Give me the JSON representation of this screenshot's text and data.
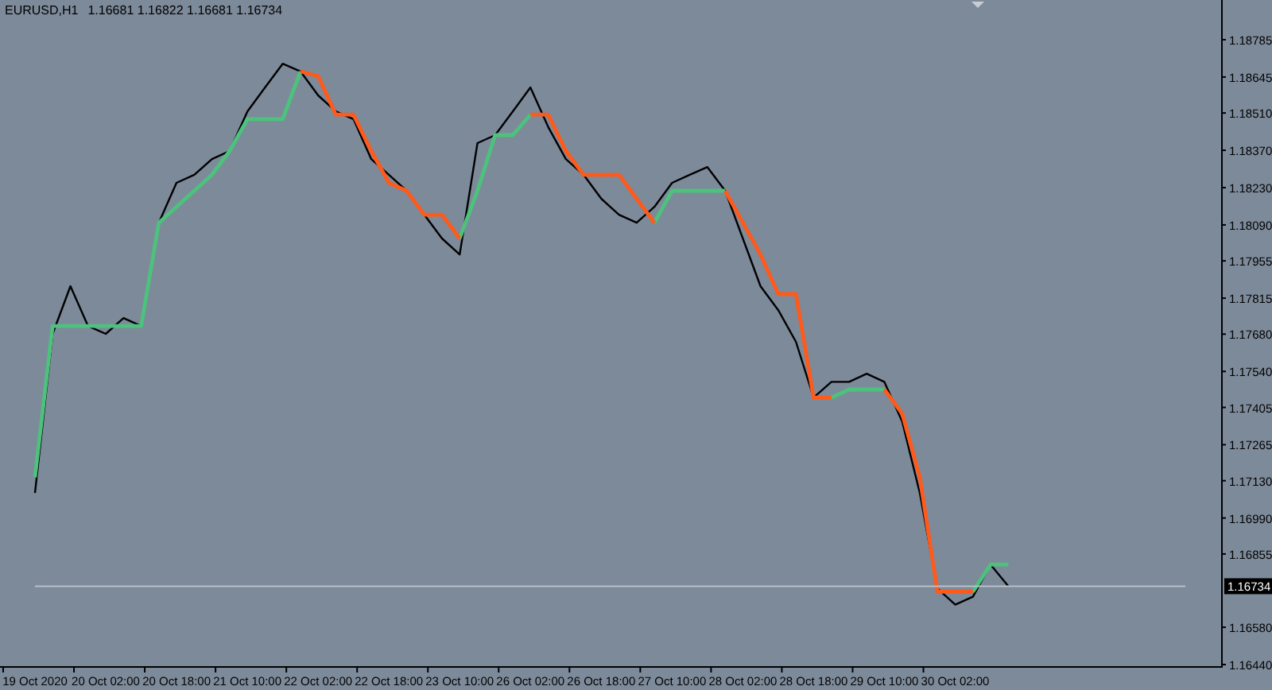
{
  "header": {
    "symbol": "EURUSD,H1",
    "quotes": "1.16681 1.16822 1.16681 1.16734"
  },
  "chart_data": {
    "type": "line",
    "categories": [
      "19 Oct 2020",
      null,
      null,
      null,
      "20 Oct 02:00",
      null,
      null,
      null,
      "20 Oct 18:00",
      null,
      null,
      null,
      "21 Oct 10:00",
      null,
      null,
      null,
      "22 Oct 02:00",
      null,
      null,
      null,
      "22 Oct 18:00",
      null,
      null,
      null,
      "23 Oct 10:00",
      null,
      null,
      null,
      "26 Oct 02:00",
      null,
      null,
      null,
      "26 Oct 18:00",
      null,
      null,
      null,
      "27 Oct 10:00",
      null,
      null,
      null,
      "28 Oct 02:00",
      null,
      null,
      null,
      "28 Oct 18:00",
      null,
      null,
      null,
      "29 Oct 10:00",
      null,
      null,
      null,
      "30 Oct 02:00",
      null,
      null,
      null,
      null,
      null,
      null,
      null,
      null,
      null,
      null,
      null,
      null,
      null
    ],
    "series": [
      {
        "color": "#000000",
        "values": [
          1.17084,
          1.17681,
          1.1786,
          1.1771,
          1.17681,
          1.1774,
          1.1771,
          1.18098,
          1.18248,
          1.18278,
          1.18337,
          1.18367,
          1.18516,
          1.18606,
          1.18695,
          1.18666,
          1.18576,
          1.18516,
          1.18487,
          1.18337,
          1.18278,
          1.18218,
          1.18128,
          1.18039,
          1.17979,
          1.18397,
          1.18427,
          1.18516,
          1.18606,
          1.18457,
          1.18337,
          1.18278,
          1.18188,
          1.18128,
          1.18098,
          1.18158,
          1.18248,
          1.18278,
          1.18307,
          1.18218,
          1.18039,
          1.1786,
          1.1777,
          1.17651,
          1.17442,
          1.17501,
          1.17501,
          1.17531,
          1.17501,
          1.17352,
          1.17084,
          1.16725,
          1.16665,
          1.16695,
          1.16815,
          1.16734,
          null,
          null,
          null,
          null,
          null,
          null,
          null,
          null,
          null,
          null
        ]
      },
      {
        "color": "#4cc27c",
        "values": [
          1.17143,
          1.1771,
          1.1771,
          1.1771,
          1.1771,
          1.1771,
          1.1771,
          1.18098,
          1.18158,
          1.18218,
          1.18278,
          1.18367,
          1.18487,
          1.18487,
          1.18487,
          1.18666,
          null,
          null,
          null,
          null,
          null,
          null,
          null,
          null,
          1.18039,
          1.18218,
          1.18427,
          1.18427,
          1.18504,
          null,
          null,
          null,
          null,
          null,
          null,
          1.18098,
          1.18218,
          1.18218,
          1.18218,
          1.18218,
          null,
          null,
          null,
          null,
          null,
          1.17442,
          1.17472,
          1.17472,
          1.17472,
          null,
          null,
          null,
          null,
          1.16713,
          1.16815,
          1.16815,
          null,
          null,
          null,
          null,
          null,
          null,
          null,
          null,
          null,
          null
        ]
      },
      {
        "color": "#ff5a1a",
        "values": [
          null,
          null,
          null,
          null,
          null,
          null,
          null,
          null,
          null,
          null,
          null,
          null,
          null,
          null,
          null,
          1.18666,
          1.18648,
          1.18504,
          1.18504,
          1.18367,
          1.18248,
          1.18218,
          1.18128,
          1.18128,
          1.18039,
          null,
          null,
          null,
          1.18504,
          1.18504,
          1.18367,
          1.18278,
          1.18278,
          1.18278,
          1.18188,
          1.18098,
          null,
          null,
          null,
          1.18218,
          1.18098,
          1.17979,
          1.1783,
          1.1783,
          1.17442,
          1.17442,
          null,
          null,
          1.17472,
          1.17382,
          1.17143,
          1.16713,
          1.16713,
          1.16713,
          null,
          null,
          null,
          null,
          null,
          null,
          null,
          null,
          null,
          null,
          null,
          null
        ]
      },
      {
        "color": "#b9c0c8",
        "values": [
          1.16734,
          1.16734,
          1.16734,
          1.16734,
          1.16734,
          1.16734,
          1.16734,
          1.16734,
          1.16734,
          1.16734,
          1.16734,
          1.16734,
          1.16734,
          1.16734,
          1.16734,
          1.16734,
          1.16734,
          1.16734,
          1.16734,
          1.16734,
          1.16734,
          1.16734,
          1.16734,
          1.16734,
          1.16734,
          1.16734,
          1.16734,
          1.16734,
          1.16734,
          1.16734,
          1.16734,
          1.16734,
          1.16734,
          1.16734,
          1.16734,
          1.16734,
          1.16734,
          1.16734,
          1.16734,
          1.16734,
          1.16734,
          1.16734,
          1.16734,
          1.16734,
          1.16734,
          1.16734,
          1.16734,
          1.16734,
          1.16734,
          1.16734,
          1.16734,
          1.16734,
          1.16734,
          1.16734,
          1.16734,
          1.16734,
          1.16734,
          1.16734,
          1.16734,
          1.16734,
          1.16734,
          1.16734,
          1.16734,
          1.16734,
          1.16734,
          1.16734
        ]
      }
    ],
    "ylim": [
      1.16434,
      1.18934
    ],
    "yticks": [
      {
        "value": 1.18785,
        "label": "1.18785"
      },
      {
        "value": 1.18645,
        "label": "1.18645"
      },
      {
        "value": 1.1851,
        "label": "1.18510"
      },
      {
        "value": 1.1837,
        "label": "1.18370"
      },
      {
        "value": 1.1823,
        "label": "1.18230"
      },
      {
        "value": 1.1809,
        "label": "1.18090"
      },
      {
        "value": 1.17955,
        "label": "1.17955"
      },
      {
        "value": 1.17815,
        "label": "1.17815"
      },
      {
        "value": 1.1768,
        "label": "1.17680"
      },
      {
        "value": 1.1754,
        "label": "1.17540"
      },
      {
        "value": 1.17405,
        "label": "1.17405"
      },
      {
        "value": 1.17265,
        "label": "1.17265"
      },
      {
        "value": 1.1713,
        "label": "1.17130"
      },
      {
        "value": 1.1699,
        "label": "1.16990"
      },
      {
        "value": 1.16855,
        "label": "1.16855"
      },
      {
        "value": 1.1658,
        "label": "1.16580"
      },
      {
        "value": 1.1644,
        "label": "1.16440"
      }
    ]
  },
  "current_price_label": "1.16734"
}
